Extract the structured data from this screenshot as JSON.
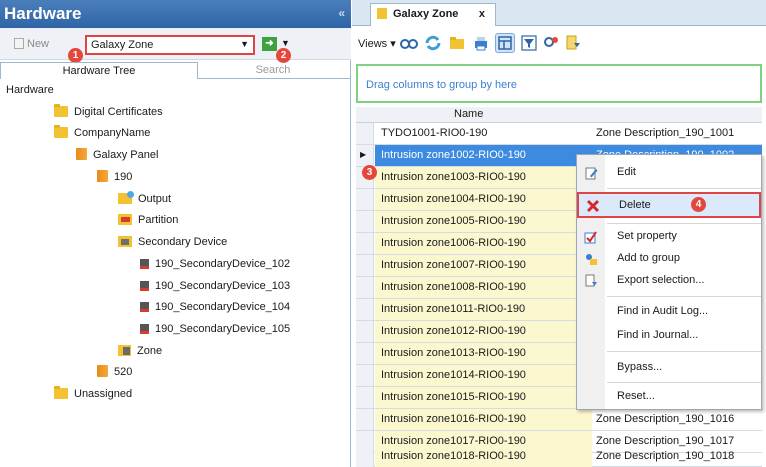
{
  "left_panel": {
    "title": "Hardware",
    "collapse_glyph": "«",
    "new_label": "New",
    "type_select_value": "Galaxy Zone",
    "go_glyph": "➜",
    "tabs": [
      "Hardware Tree",
      "Search"
    ],
    "tree": {
      "root": "Hardware",
      "digital_certificates": "Digital Certificates",
      "company": "CompanyName",
      "panel": "Galaxy Panel",
      "node_190": "190",
      "output": "Output",
      "partition": "Partition",
      "secondary_device": "Secondary Device",
      "devices": [
        "190_SecondaryDevice_102",
        "190_SecondaryDevice_103",
        "190_SecondaryDevice_104",
        "190_SecondaryDevice_105"
      ],
      "zone": "Zone",
      "node_520": "520",
      "unassigned": "Unassigned"
    }
  },
  "right_panel": {
    "tab_label": "Galaxy Zone",
    "tab_close": "x",
    "views_label": "Views",
    "group_hint": "Drag columns to group by here",
    "column_name": "Name",
    "rows": [
      {
        "name": "TYDO1001-RIO0-190",
        "desc": "Zone Description_190_1001"
      },
      {
        "name": "Intrusion zone1002-RIO0-190",
        "desc": "Zone Description_190_1002"
      },
      {
        "name": "Intrusion zone1003-RIO0-190",
        "desc": ""
      },
      {
        "name": "Intrusion zone1004-RIO0-190",
        "desc": ""
      },
      {
        "name": "Intrusion zone1005-RIO0-190",
        "desc": ""
      },
      {
        "name": "Intrusion zone1006-RIO0-190",
        "desc": ""
      },
      {
        "name": "Intrusion zone1007-RIO0-190",
        "desc": ""
      },
      {
        "name": "Intrusion zone1008-RIO0-190",
        "desc": ""
      },
      {
        "name": "Intrusion zone1011-RIO0-190",
        "desc": ""
      },
      {
        "name": "Intrusion zone1012-RIO0-190",
        "desc": ""
      },
      {
        "name": "Intrusion zone1013-RIO0-190",
        "desc": ""
      },
      {
        "name": "Intrusion zone1014-RIO0-190",
        "desc": ""
      },
      {
        "name": "Intrusion zone1015-RIO0-190",
        "desc": ""
      },
      {
        "name": "Intrusion zone1016-RIO0-190",
        "desc": "Zone Description_190_1016"
      },
      {
        "name": "Intrusion zone1017-RIO0-190",
        "desc": "Zone Description_190_1017"
      },
      {
        "name": "Intrusion zone1018-RIO0-190",
        "desc": "Zone Description_190_1018"
      }
    ]
  },
  "context_menu": {
    "edit": "Edit",
    "delete": "Delete",
    "set_property": "Set property",
    "add_to_group": "Add to group",
    "export_selection": "Export selection...",
    "find_audit": "Find in Audit Log...",
    "find_journal": "Find in Journal...",
    "bypass": "Bypass...",
    "reset": "Reset..."
  },
  "callouts": [
    "1",
    "2",
    "3",
    "4"
  ],
  "colors": {
    "header_blue": "#2f64a6",
    "selection_blue": "#3d8be0",
    "highlight_red": "#e04545",
    "row_yellow": "#fbf7cf",
    "group_border_green": "#7fd07f"
  }
}
